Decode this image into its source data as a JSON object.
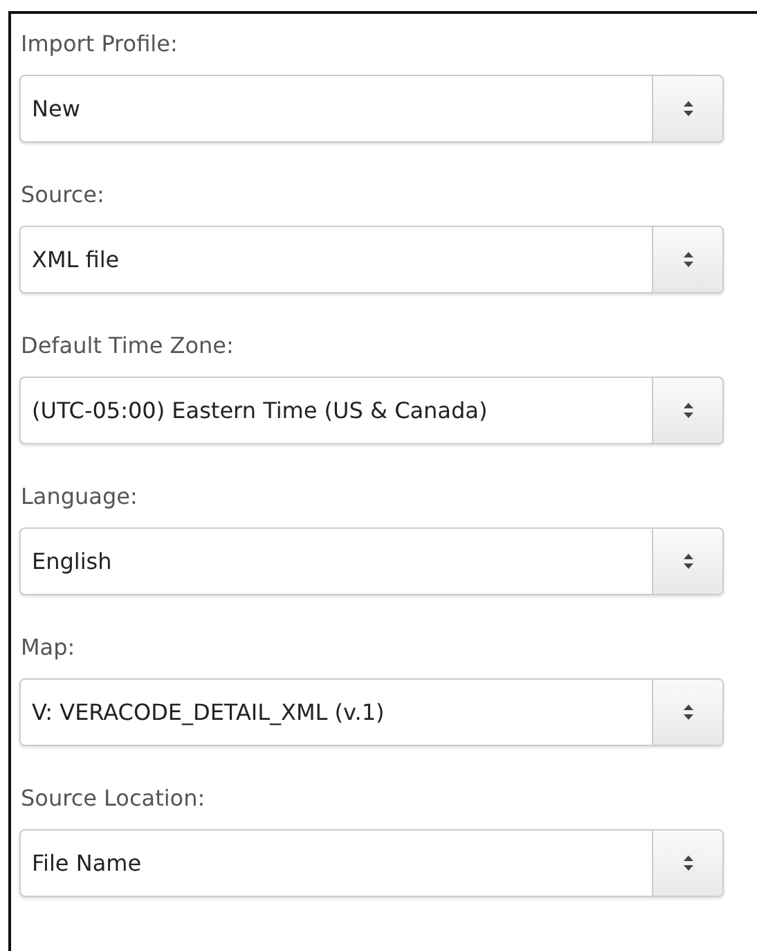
{
  "fields": [
    {
      "label": "Import Profile:",
      "value": "New"
    },
    {
      "label": "Source:",
      "value": "XML file"
    },
    {
      "label": "Default Time Zone:",
      "value": "(UTC-05:00) Eastern Time (US & Canada)"
    },
    {
      "label": "Language:",
      "value": "English"
    },
    {
      "label": "Map:",
      "value": "V: VERACODE_DETAIL_XML (v.1)"
    },
    {
      "label": "Source Location:",
      "value": "File Name"
    }
  ]
}
